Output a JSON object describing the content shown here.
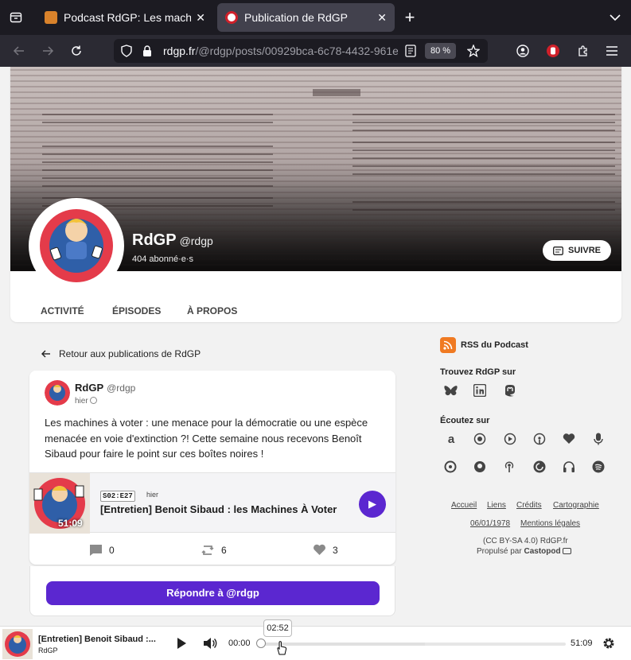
{
  "browser": {
    "tabs": [
      {
        "title": "Podcast RdGP: Les machines à voter",
        "active": false
      },
      {
        "title": "Publication de RdGP",
        "active": true
      }
    ],
    "url_host": "rdgp.fr",
    "url_path": "/@rdgp/posts/00929bca-6c78-4432-961e",
    "zoom": "80 %"
  },
  "profile": {
    "name": "RdGP",
    "handle": "@rdgp",
    "subscribers": "404 abonné·e·s",
    "follow_label": "SUIVRE",
    "avatar_text": "Rien De Grave Patron !",
    "tabs": [
      "ACTIVITÉ",
      "ÉPISODES",
      "À PROPOS"
    ]
  },
  "back_link": "Retour aux publications de RdGP",
  "post": {
    "author": "RdGP",
    "handle": "@rdgp",
    "time": "hier",
    "body": "Les machines à voter : une menace pour la démocratie ou une espèce menacée en voie d'extinction ?! Cette semaine nous recevons Benoît Sibaud pour faire le point sur ces boîtes noires !",
    "episode": {
      "code": "S02:E27",
      "when": "hier",
      "title": "[Entretien] Benoit Sibaud : les Machines À Voter",
      "duration": "51:09"
    },
    "actions": {
      "comments": "0",
      "reblogs": "6",
      "favourites": "3"
    },
    "reply_label": "Répondre à @rdgp"
  },
  "sidebar": {
    "rss_label": "RSS du Podcast",
    "find_title": "Trouvez RdGP sur",
    "social_icons": [
      "bluesky-icon",
      "linkedin-icon",
      "mastodon-icon"
    ],
    "listen_title": "Écoutez sur",
    "listen_icons": [
      "amazon-icon",
      "podcast-addict-icon",
      "podcast-index-icon",
      "apple-podcasts-icon",
      "deezer-icon",
      "microphone-icon",
      "overcast-icon",
      "podcast-guru-icon",
      "podcasts-icon",
      "pocket-casts-icon",
      "headphones-icon",
      "spotify-icon"
    ],
    "footer_links": [
      "Accueil",
      "Liens",
      "Crédits",
      "Cartographie",
      "06/01/1978",
      "Mentions légales"
    ],
    "license": "(CC BY-SA 4.0) RdGP.fr",
    "powered_by": "Propulsé par",
    "powered_name": "Castopod"
  },
  "player": {
    "title": "[Entretien] Benoit Sibaud :...",
    "author": "RdGP",
    "current": "00:00",
    "total": "51:09",
    "tooltip": "02:52",
    "progress_fraction": 0.0,
    "buffered_fraction": 0.54
  },
  "colors": {
    "accent": "#5b27d0",
    "rss": "#f07a22",
    "chrome_dark": "#1c1b22"
  }
}
